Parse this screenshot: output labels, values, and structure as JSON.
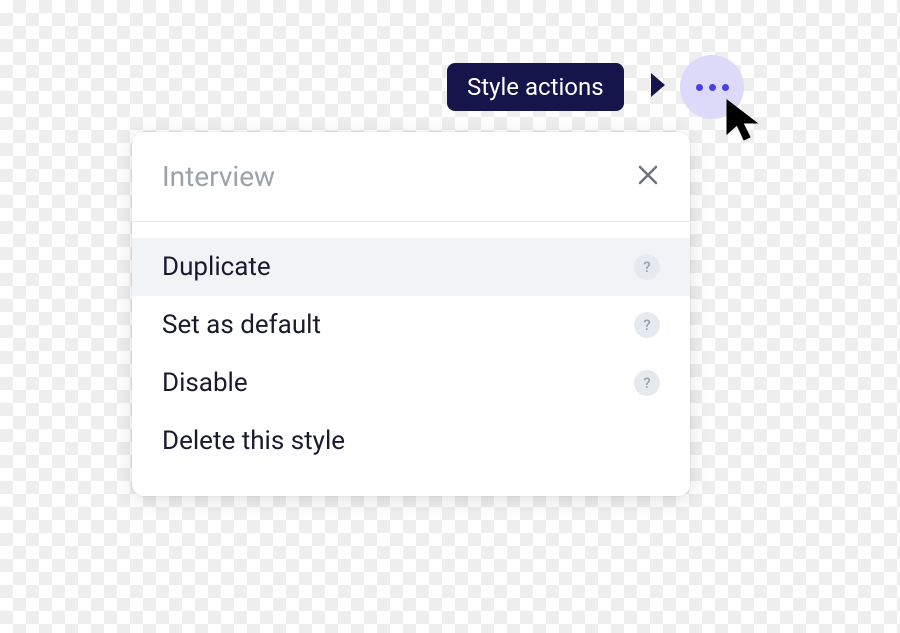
{
  "tooltip": {
    "label": "Style actions"
  },
  "panel": {
    "title": "Interview",
    "items": [
      {
        "label": "Duplicate",
        "has_help": true,
        "hovered": true
      },
      {
        "label": "Set as default",
        "has_help": true,
        "hovered": false
      },
      {
        "label": "Disable",
        "has_help": true,
        "hovered": false
      },
      {
        "label": "Delete this style",
        "has_help": false,
        "hovered": false
      }
    ]
  },
  "help_glyph": "?"
}
